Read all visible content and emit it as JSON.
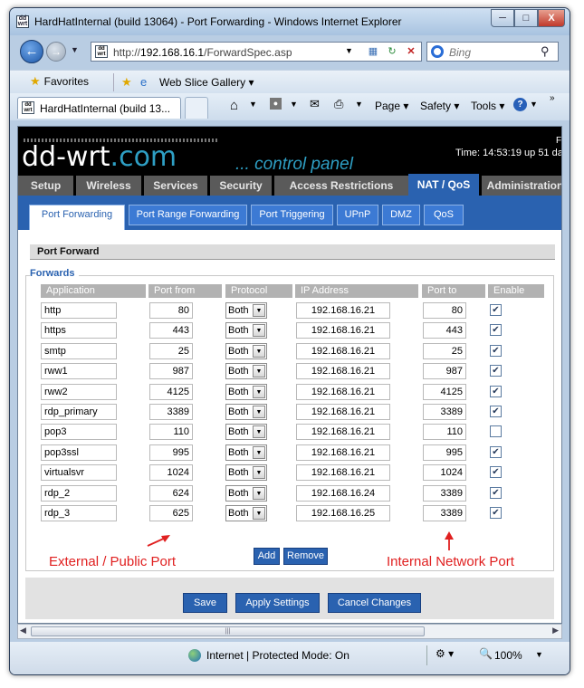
{
  "window": {
    "title": "HardHatInternal (build 13064) - Port Forwarding - Windows Internet Explorer",
    "min": "─",
    "max": "□",
    "close": "X"
  },
  "nav": {
    "url_prefix": "http://",
    "url_host": "192.168.16.1",
    "url_path": "/ForwardSpec.asp",
    "search_placeholder": "Bing"
  },
  "favbar": {
    "favorites": "Favorites",
    "web_slice": "Web Slice Gallery ▾"
  },
  "tabbar": {
    "tab_title": "HardHatInternal (build 13...",
    "page": "Page ▾",
    "safety": "Safety ▾",
    "tools": "Tools ▾"
  },
  "router": {
    "logo_main": "dd-wrt",
    "logo_com": ".com",
    "panel": "... control panel",
    "time": "Time: 14:53:19 up 51 da",
    "corner": "F",
    "main_tabs": [
      "Setup",
      "Wireless",
      "Services",
      "Security",
      "Access Restrictions",
      "NAT / QoS",
      "Administration"
    ],
    "sub_tabs": [
      "Port Forwarding",
      "Port Range Forwarding",
      "Port Triggering",
      "UPnP",
      "DMZ",
      "QoS"
    ],
    "section_title": "Port Forward",
    "fieldset_legend": "Forwards",
    "columns": [
      "Application",
      "Port from",
      "Protocol",
      "IP Address",
      "Port to",
      "Enable"
    ],
    "rows": [
      {
        "app": "http",
        "from": "80",
        "proto": "Both",
        "ip": "192.168.16.21",
        "to": "80",
        "enabled": true
      },
      {
        "app": "https",
        "from": "443",
        "proto": "Both",
        "ip": "192.168.16.21",
        "to": "443",
        "enabled": true
      },
      {
        "app": "smtp",
        "from": "25",
        "proto": "Both",
        "ip": "192.168.16.21",
        "to": "25",
        "enabled": true
      },
      {
        "app": "rww1",
        "from": "987",
        "proto": "Both",
        "ip": "192.168.16.21",
        "to": "987",
        "enabled": true
      },
      {
        "app": "rww2",
        "from": "4125",
        "proto": "Both",
        "ip": "192.168.16.21",
        "to": "4125",
        "enabled": true
      },
      {
        "app": "rdp_primary",
        "from": "3389",
        "proto": "Both",
        "ip": "192.168.16.21",
        "to": "3389",
        "enabled": true
      },
      {
        "app": "pop3",
        "from": "110",
        "proto": "Both",
        "ip": "192.168.16.21",
        "to": "110",
        "enabled": false
      },
      {
        "app": "pop3ssl",
        "from": "995",
        "proto": "Both",
        "ip": "192.168.16.21",
        "to": "995",
        "enabled": true
      },
      {
        "app": "virtualsvr",
        "from": "1024",
        "proto": "Both",
        "ip": "192.168.16.21",
        "to": "1024",
        "enabled": true
      },
      {
        "app": "rdp_2",
        "from": "624",
        "proto": "Both",
        "ip": "192.168.16.24",
        "to": "3389",
        "enabled": true
      },
      {
        "app": "rdp_3",
        "from": "625",
        "proto": "Both",
        "ip": "192.168.16.25",
        "to": "3389",
        "enabled": true
      }
    ],
    "add": "Add",
    "remove": "Remove",
    "annotation_external": "External / Public Port",
    "annotation_internal": "Internal Network Port",
    "save": "Save",
    "apply": "Apply Settings",
    "cancel": "Cancel Changes"
  },
  "status": {
    "text": "Internet | Protected Mode: On",
    "zoom": "100%"
  }
}
